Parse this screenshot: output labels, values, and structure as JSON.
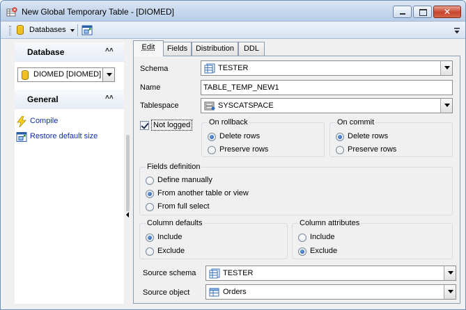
{
  "window": {
    "title": "New Global Temporary Table - [DIOMED]",
    "close_glyph": "✕"
  },
  "toolbar": {
    "databases_label": "Databases"
  },
  "left_panel": {
    "database_header": "Database",
    "database_value": "DIOMED [DIOMED]",
    "general_header": "General",
    "links": [
      {
        "label": "Compile",
        "icon": "lightning-icon"
      },
      {
        "label": "Restore default size",
        "icon": "restore-size-icon"
      }
    ],
    "collapse_glyph": "˄˄"
  },
  "tabs": [
    {
      "label": "Edit",
      "active": true
    },
    {
      "label": "Fields",
      "active": false
    },
    {
      "label": "Distribution",
      "active": false
    },
    {
      "label": "DDL",
      "active": false
    }
  ],
  "form": {
    "schema_label": "Schema",
    "schema_value": "TESTER",
    "name_label": "Name",
    "name_value": "TABLE_TEMP_NEW1",
    "tablespace_label": "Tablespace",
    "tablespace_value": "SYSCATSPACE",
    "not_logged_label": "Not logged",
    "not_logged_checked": true,
    "on_rollback": {
      "title": "On rollback",
      "options": [
        "Delete rows",
        "Preserve rows"
      ],
      "selected": "Delete rows"
    },
    "on_commit": {
      "title": "On commit",
      "options": [
        "Delete rows",
        "Preserve rows"
      ],
      "selected": "Delete rows"
    },
    "fields_definition": {
      "title": "Fields definition",
      "options": [
        "Define manually",
        "From another table or view",
        "From full select"
      ],
      "selected": "From another table or view"
    },
    "column_defaults": {
      "title": "Column defaults",
      "options": [
        "Include",
        "Exclude"
      ],
      "selected": "Include"
    },
    "column_attributes": {
      "title": "Column attributes",
      "options": [
        "Include",
        "Exclude"
      ],
      "selected": "Exclude"
    },
    "source_schema_label": "Source schema",
    "source_schema_value": "TESTER",
    "source_object_label": "Source object",
    "source_object_value": "Orders"
  }
}
